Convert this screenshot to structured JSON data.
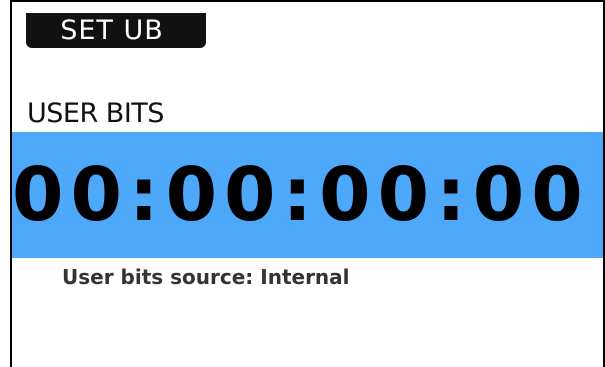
{
  "header": {
    "title": "SET UB"
  },
  "user_bits": {
    "label": "USER BITS",
    "value": "00:00:00:00",
    "source_line": "User bits source: Internal"
  },
  "colors": {
    "accent_band": "#4ea8fa",
    "title_tab_bg": "#111111",
    "title_tab_text": "#ffffff"
  }
}
